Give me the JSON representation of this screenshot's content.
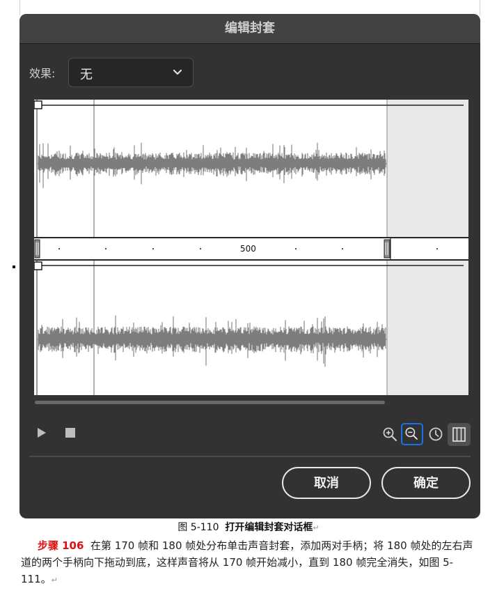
{
  "dialog": {
    "title": "编辑封套",
    "effect_label": "效果:",
    "effect_value": "无",
    "ruler_label": "500",
    "cancel_label": "取消",
    "ok_label": "确定"
  },
  "icons": {
    "play": "play-icon",
    "stop": "stop-icon",
    "zoom_in": "zoom-in-icon",
    "zoom_out": "zoom-out-icon",
    "time": "clock-icon",
    "frames": "frames-icon",
    "dropdown": "chevron-down-icon"
  },
  "colors": {
    "dialog_bg": "#323232",
    "accent": "#1b72e8",
    "waveform": "#7d7d7d",
    "step_label": "#e01010"
  },
  "document": {
    "caption_prefix": "图 5-110",
    "caption_title": "打开编辑封套对话框",
    "caption_mark": "↵",
    "step_label": "步骤 106",
    "step_text": "在第 170 帧和 180 帧处分布单击声音封套，添加两对手柄；将 180 帧处的左右声道的两个手柄向下拖动到底，这样声音将从 170 帧开始减小，直到 180 帧完全消失，如图 5-111。",
    "step_mark": "↵"
  }
}
